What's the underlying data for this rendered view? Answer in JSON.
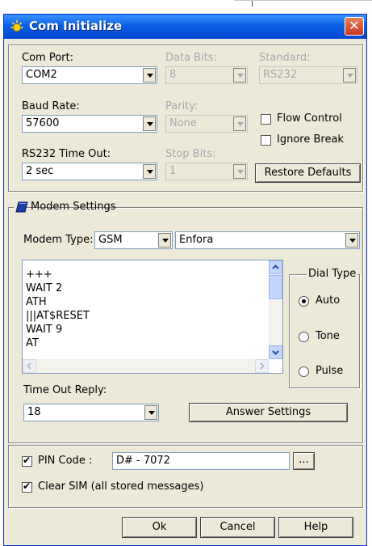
{
  "window": {
    "title": "Com Initialize",
    "close_symbol": "✕"
  },
  "com": {
    "com_port_label": "Com Port:",
    "com_port_value": "COM2",
    "baud_rate_label": "Baud Rate:",
    "baud_rate_value": "57600",
    "timeout_label": "RS232 Time Out:",
    "timeout_value": "2 sec",
    "data_bits_label": "Data Bits:",
    "data_bits_value": "8",
    "parity_label": "Parity:",
    "parity_value": "None",
    "stop_bits_label": "Stop Bits:",
    "stop_bits_value": "1",
    "standard_label": "Standard:",
    "standard_value": "RS232",
    "flow_control_label": "Flow Control",
    "flow_control_checked": false,
    "ignore_break_label": "Ignore Break",
    "ignore_break_checked": false,
    "restore_defaults_label": "Restore Defaults"
  },
  "modem": {
    "group_label": "Modem Settings",
    "type_label": "Modem Type:",
    "type_value": "GSM",
    "model_value": "Enfora",
    "script_lines": [
      "+++",
      "WAIT 2",
      "ATH",
      "|||AT$RESET",
      "WAIT 9",
      "AT"
    ],
    "dial_type_label": "Dial Type",
    "dial_options": [
      "Auto",
      "Tone",
      "Pulse"
    ],
    "dial_selected": "Auto",
    "timeout_reply_label": "Time Out Reply:",
    "timeout_reply_value": "18",
    "answer_settings_label": "Answer Settings"
  },
  "pin": {
    "pin_label": "PIN Code :",
    "pin_checked": true,
    "pin_value": "D# - 7072",
    "browse_label": "...",
    "clear_sim_label": "Clear SIM (all stored messages)",
    "clear_sim_checked": true
  },
  "buttons": {
    "ok": "Ok",
    "cancel": "Cancel",
    "help": "Help"
  }
}
